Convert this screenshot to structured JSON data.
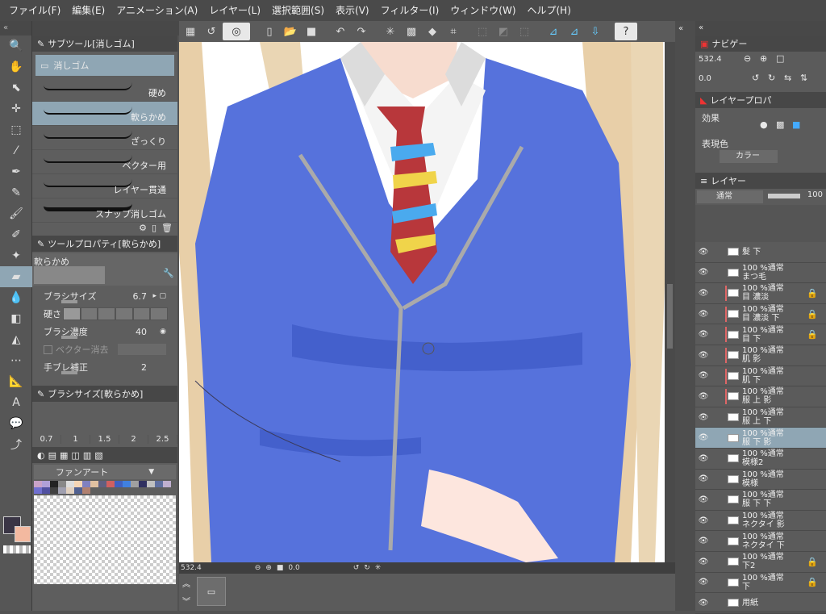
{
  "menu": [
    "ファイル(F)",
    "編集(E)",
    "アニメーション(A)",
    "レイヤー(L)",
    "選択範囲(S)",
    "表示(V)",
    "フィルター(I)",
    "ウィンドウ(W)",
    "ヘルプ(H)"
  ],
  "subtool": {
    "title": "サブツール[消しゴム]",
    "active_tab": "消しゴム",
    "brushes": [
      {
        "label": "硬め"
      },
      {
        "label": "軟らかめ"
      },
      {
        "label": "ざっくり"
      },
      {
        "label": "ベクター用"
      },
      {
        "label": "レイヤー貫通"
      },
      {
        "label": "スナップ消しゴム"
      }
    ]
  },
  "toolprop": {
    "title": "ツールプロパティ[軟らかめ]",
    "preset": "軟らかめ",
    "brush_size_label": "ブラシサイズ",
    "brush_size_value": "6.7",
    "hardness_label": "硬さ",
    "density_label": "ブラシ濃度",
    "density_value": "40",
    "vector_erase_label": "ベクター消去",
    "stabilization_label": "手ブレ補正",
    "stabilization_value": "2"
  },
  "brushsize": {
    "title": "ブラシサイズ[軟らかめ]",
    "sizes": [
      "0.7",
      "1",
      "1.5",
      "2",
      "2.5"
    ]
  },
  "color_set": {
    "name": "ファンアート"
  },
  "canvas": {
    "zoom": "532.4",
    "rotation": "0.0"
  },
  "navigator": {
    "title": "ナビゲー",
    "zoom": "532.4",
    "rotation": "0.0"
  },
  "layer_property": {
    "title": "レイヤープロパ",
    "effect_label": "効果",
    "color_label": "表現色",
    "color_value": "カラー"
  },
  "layer_panel": {
    "title": "レイヤー",
    "blend": "通常",
    "opacity": "100",
    "layers": [
      {
        "line1": "",
        "line2": "髪 下",
        "locked": false,
        "selected": false
      },
      {
        "line1": "100 %通常",
        "line2": "まつ毛",
        "locked": false,
        "selected": false
      },
      {
        "line1": "100 %通常",
        "line2": "目 濃淡",
        "locked": true,
        "selected": false
      },
      {
        "line1": "100 %通常",
        "line2": "目 濃淡 下",
        "locked": true,
        "selected": false
      },
      {
        "line1": "100 %通常",
        "line2": "目 下",
        "locked": true,
        "selected": false
      },
      {
        "line1": "100 %通常",
        "line2": "肌 影",
        "locked": false,
        "selected": false
      },
      {
        "line1": "100 %通常",
        "line2": "肌 下",
        "locked": false,
        "selected": false
      },
      {
        "line1": "100 %通常",
        "line2": "服 上 影",
        "locked": false,
        "selected": false
      },
      {
        "line1": "100 %通常",
        "line2": "服 上 下",
        "locked": false,
        "selected": false
      },
      {
        "line1": "100 %通常",
        "line2": "服 下 影",
        "locked": false,
        "selected": true
      },
      {
        "line1": "100 %通常",
        "line2": "模様2",
        "locked": false,
        "selected": false
      },
      {
        "line1": "100 %通常",
        "line2": "模様",
        "locked": false,
        "selected": false
      },
      {
        "line1": "100 %通常",
        "line2": "服 下 下",
        "locked": false,
        "selected": false
      },
      {
        "line1": "100 %通常",
        "line2": "ネクタイ 影",
        "locked": false,
        "selected": false
      },
      {
        "line1": "100 %通常",
        "line2": "ネクタイ 下",
        "locked": false,
        "selected": false
      },
      {
        "line1": "100 %通常",
        "line2": "下2",
        "locked": true,
        "selected": false
      },
      {
        "line1": "100 %通常",
        "line2": "下",
        "locked": true,
        "selected": false
      },
      {
        "line1": "",
        "line2": "用紙",
        "locked": false,
        "selected": false
      }
    ]
  }
}
